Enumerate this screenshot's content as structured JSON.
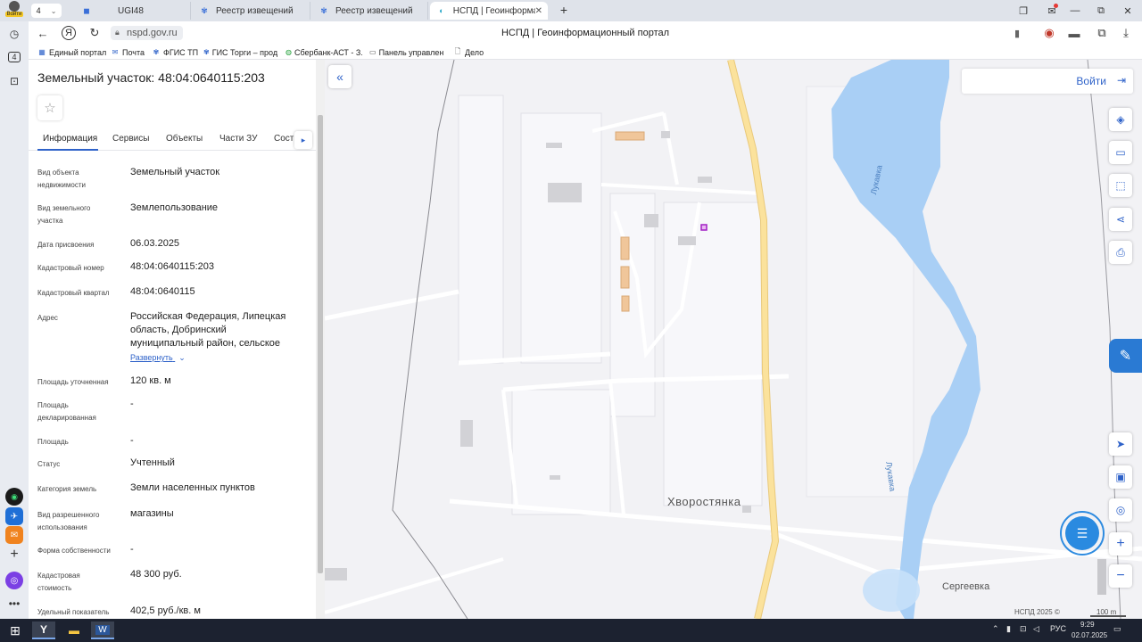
{
  "browser": {
    "profile_label": "Войти",
    "tab_counter": "4",
    "tabs": [
      {
        "title": "UGI48",
        "active": false
      },
      {
        "title": "Реестр извещений",
        "active": false
      },
      {
        "title": "Реестр извещений",
        "active": false
      },
      {
        "title": "НСПД | Геоинформационный портал",
        "active": true
      }
    ],
    "new_tab": "+",
    "url": "nspd.gov.ru",
    "page_title": "НСПД | Геоинформационный портал",
    "bookmarks": [
      "Единый портал",
      "Почта",
      "ФГИС ТП",
      "ГИС Торги – прод...",
      "Сбербанк-АСТ - З...",
      "Панель управлен...",
      "Дело"
    ],
    "sidebar_counter": "4"
  },
  "panel": {
    "title": "Земельный участок: 48:04:0640115:203",
    "tabs": [
      "Информация",
      "Сервисы",
      "Объекты",
      "Части ЗУ",
      "Состав"
    ],
    "expand_label": "Развернуть",
    "rows": [
      {
        "label": "Вид объекта недвижимости",
        "value": "Земельный участок"
      },
      {
        "label": "Вид земельного участка",
        "value": "Землепользование"
      },
      {
        "label": "Дата присвоения",
        "value": "06.03.2025"
      },
      {
        "label": "Кадастровый номер",
        "value": "48:04:0640115:203"
      },
      {
        "label": "Кадастровый квартал",
        "value": "48:04:0640115"
      },
      {
        "label": "Адрес",
        "value": "Российская Федерация, Липецкая область, Добринский муниципальный район, сельское"
      },
      {
        "label": "Площадь уточненная",
        "value": "120 кв. м"
      },
      {
        "label": "Площадь декларированная",
        "value": "-"
      },
      {
        "label": "Площадь",
        "value": "-"
      },
      {
        "label": "Статус",
        "value": "Учтенный"
      },
      {
        "label": "Категория земель",
        "value": "Земли населенных пунктов"
      },
      {
        "label": "Вид разрешенного использования",
        "value": "магазины"
      },
      {
        "label": "Форма собственности",
        "value": "-"
      },
      {
        "label": "Кадастровая стоимость",
        "value": "48 300 руб."
      },
      {
        "label": "Удельный показатель",
        "value": "402,5 руб./кв. м"
      }
    ]
  },
  "map": {
    "login_label": "Войти",
    "labels": {
      "village_main": "Хворостянка",
      "village_second": "Сергеевка",
      "river_upper": "Лукавка",
      "river_lower": "Лукавка"
    },
    "copyright": "НСПД 2025 ©",
    "scale": "100 m",
    "colors": {
      "water": "#a9cff5",
      "road": "#f9dd8e",
      "building": "#f0c69a",
      "accent": "#2e62c9"
    }
  },
  "taskbar": {
    "lang": "РУС",
    "time": "9:29",
    "date": "02.07.2025"
  }
}
